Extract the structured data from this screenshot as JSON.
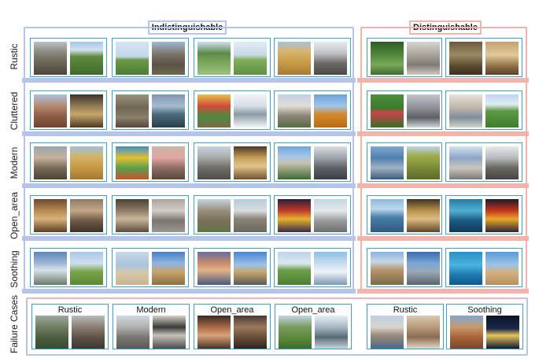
{
  "headers": {
    "indistinguishable": "Indistinguishable",
    "distinguishable": "Distinguishable"
  },
  "rows": [
    {
      "label": "Rustic"
    },
    {
      "label": "Cluttered"
    },
    {
      "label": "Modern"
    },
    {
      "label": "Open_area"
    },
    {
      "label": "Soothing"
    }
  ],
  "failure": {
    "label": "Failure Cases",
    "captions": [
      "Rustic",
      "Modern",
      "Open_area",
      "Open_area",
      "Rustic",
      "Soothing"
    ]
  },
  "colors": {
    "indistinguishable_border": "#b4c4ea",
    "distinguishable_border": "#f2b3aa",
    "pair_border": "#3aa0d8"
  }
}
